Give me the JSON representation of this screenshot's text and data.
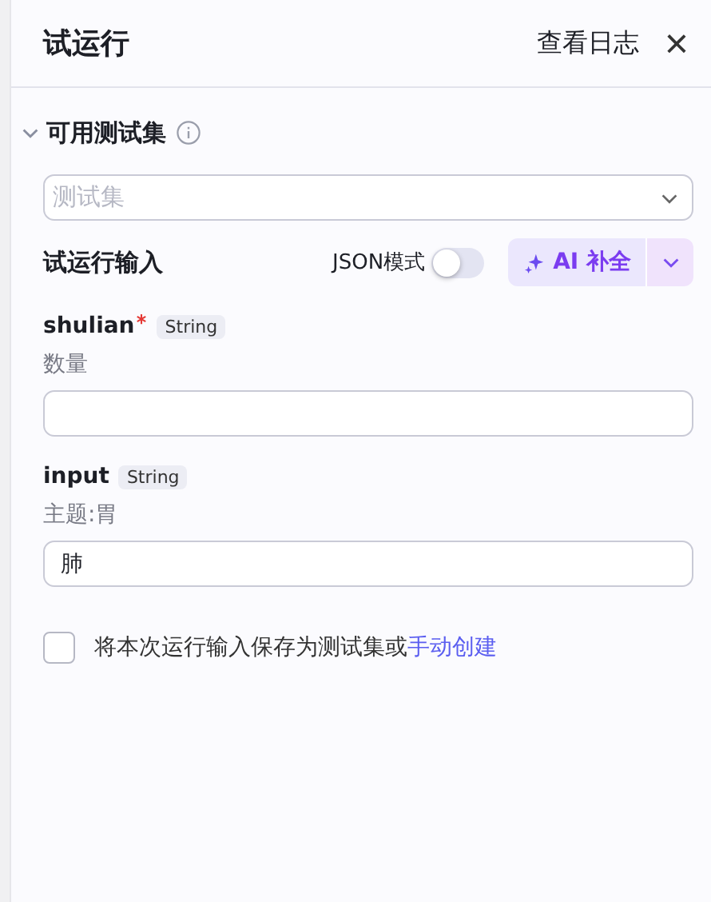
{
  "header": {
    "title": "试运行",
    "log_link": "查看日志",
    "close": "×"
  },
  "testset": {
    "label": "可用测试集",
    "expanded": true,
    "select_placeholder": "测试集"
  },
  "run_input": {
    "label": "试运行输入",
    "json_mode_label": "JSON模式",
    "json_mode_on": false,
    "ai_button": "AI 补全"
  },
  "fields": [
    {
      "name": "shulian",
      "required": true,
      "type": "String",
      "description": "数量"
    },
    {
      "name": "input",
      "required": false,
      "type": "String",
      "description": "主题:胃",
      "value": "肺"
    }
  ],
  "save": {
    "checked": false,
    "text": "将本次运行输入保存为测试集或",
    "link": "手动创建"
  }
}
